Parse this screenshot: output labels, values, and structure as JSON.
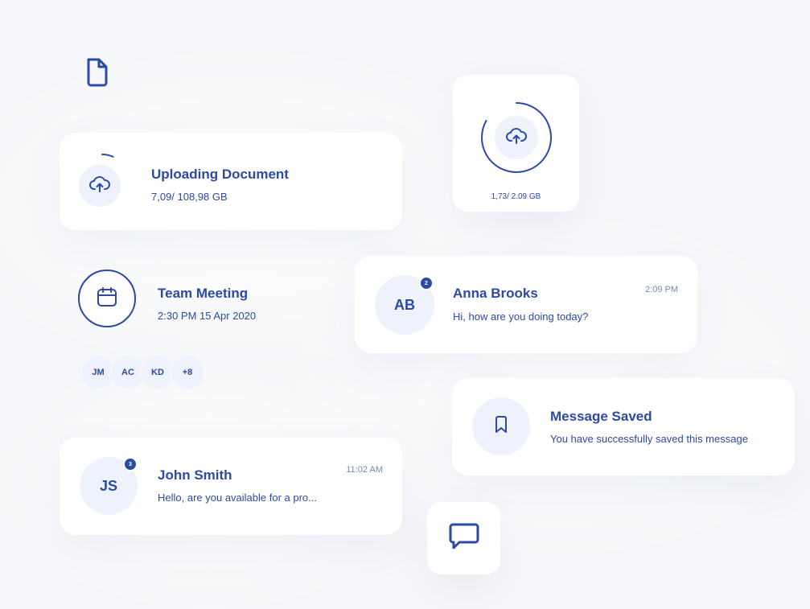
{
  "icons": {
    "document": "document-icon",
    "cloud_upload": "cloud-upload-icon",
    "calendar": "calendar-icon",
    "bookmark": "bookmark-icon",
    "chat": "chat-icon"
  },
  "colors": {
    "accent": "#2a4aa5",
    "avatar_bg": "#edf2fd",
    "background": "#f6f7fa"
  },
  "upload_card": {
    "title": "Uploading Document",
    "size_text": "7,09/ 108,98 GB",
    "progress": 0.065
  },
  "upload_widget": {
    "size_text": "1,73/ 2.09 GB",
    "progress": 0.83
  },
  "meeting": {
    "title": "Team Meeting",
    "datetime": "2:30 PM 15 Apr 2020",
    "attendees": [
      "JM",
      "AC",
      "KD",
      "+8"
    ]
  },
  "chats": [
    {
      "initials": "AB",
      "name": "Anna Brooks",
      "message": "Hi, how are you doing today?",
      "time": "2:09 PM",
      "unread": "2"
    },
    {
      "initials": "JS",
      "name": "John Smith",
      "message": "Hello, are you available for a pro...",
      "time": "11:02 AM",
      "unread": "3"
    }
  ],
  "saved_card": {
    "title": "Message Saved",
    "message": "You have successfully saved this message"
  }
}
